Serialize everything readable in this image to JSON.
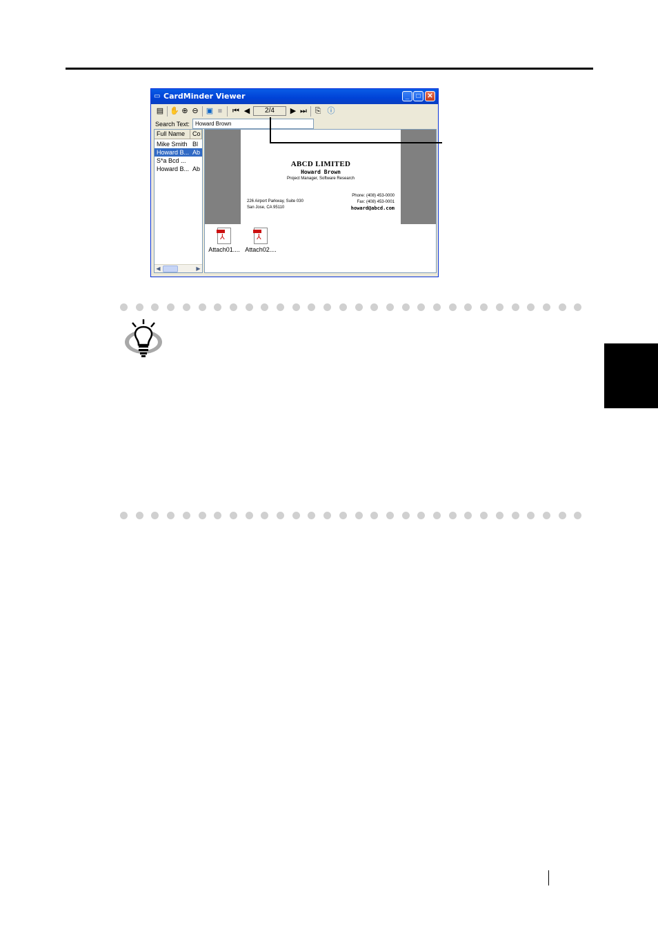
{
  "window": {
    "title": "CardMinder Viewer",
    "minimize_glyph": "_",
    "maximize_glyph": "□",
    "close_glyph": "✕"
  },
  "toolbar": {
    "page_indicator": "2/4",
    "tools": [
      "view-icon",
      "hand-icon",
      "zoom-in-icon",
      "zoom-out-icon",
      "front-side-icon",
      "back-side-icon",
      "first-page-icon",
      "previous-page-icon",
      "next-page-icon",
      "last-page-icon",
      "copy-icon",
      "info-icon"
    ]
  },
  "search": {
    "label": "Search Text:",
    "value": "Howard Brown"
  },
  "list": {
    "columns": [
      "Full Name",
      "Co"
    ],
    "rows": [
      {
        "name": "Mike Smith",
        "company": "Bl"
      },
      {
        "name": "Howard B...",
        "company": "Ab"
      },
      {
        "name": "S*a Bcd ...",
        "company": ""
      },
      {
        "name": "Howard B...",
        "company": "Ab"
      }
    ],
    "selected_row": 1
  },
  "card": {
    "company": "ABCD LIMITED",
    "name": "Howard Brown",
    "title": "Project Manager, Software Research",
    "address_line1": "226 Airport Parkway, Suite 030",
    "address_line2": "San Jose, CA 95110",
    "phone": "Phone: (408) 453-0000",
    "fax": "Fax: (408) 453-0001",
    "email": "howard@abcd.com"
  },
  "attachments": [
    {
      "label": "Attach01....",
      "icon": "pdf-file-icon"
    },
    {
      "label": "Attach02....",
      "icon": "pdf-file-icon"
    }
  ],
  "colors": {
    "titlebar": "#0042d6",
    "selection": "#316ac5",
    "side_tab": "#000000"
  }
}
